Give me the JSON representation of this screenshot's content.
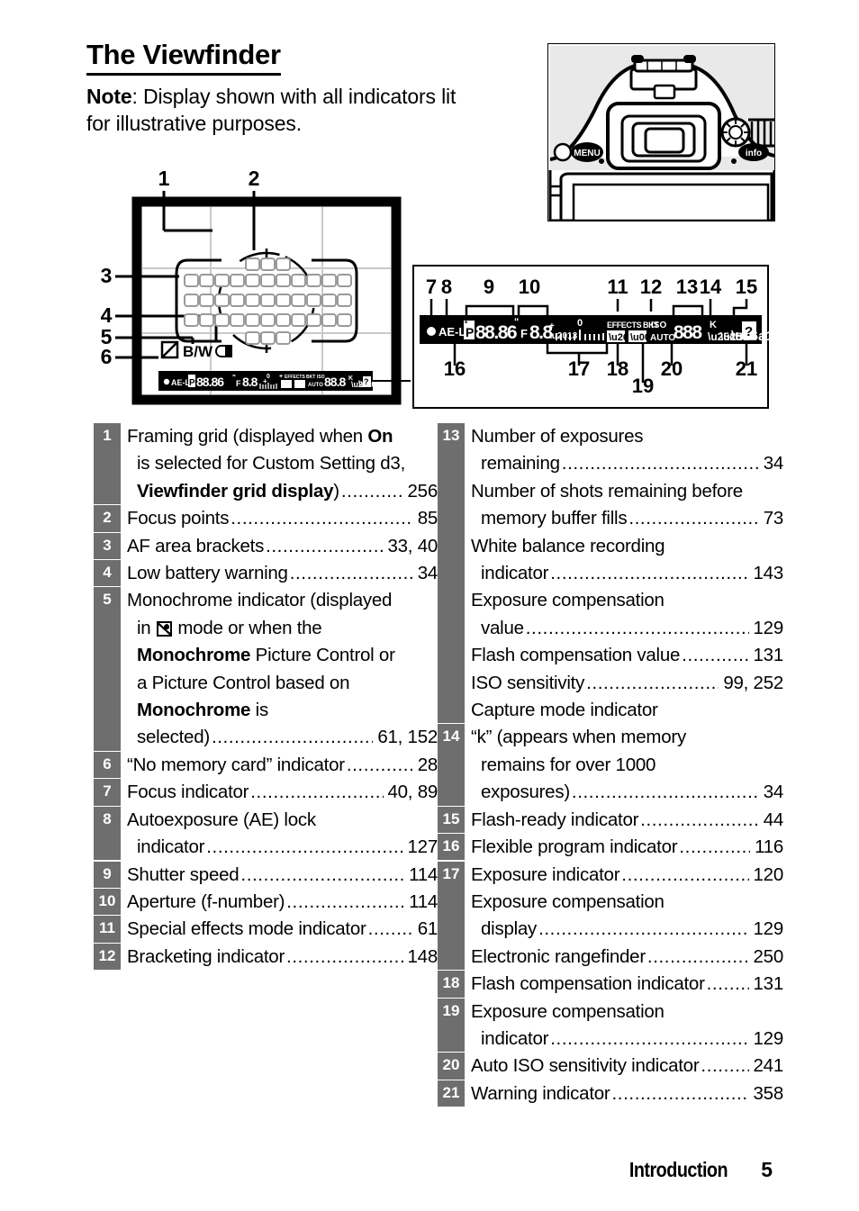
{
  "header": {
    "title": "The Viewfinder",
    "note_bold": "Note",
    "note_rest": ": Display shown with all indicators lit",
    "note_line2": "for illustrative purposes."
  },
  "camera_figure": {
    "name": "camera-rear-view",
    "buttons": [
      "MENU",
      "info"
    ]
  },
  "viewfinder": {
    "monochrome_label": "B/W",
    "status_bar": {
      "focus_dot": "●",
      "ae_lock": "AE-L",
      "flexible_program": "P",
      "shutter_speed": "88.86\"",
      "aperture_prefix": "F",
      "aperture": "8.8",
      "exposure_zero": "0",
      "plus": "+",
      "minus": "–",
      "effects": "EFFECTS",
      "bkt": "BKT",
      "iso": "ISO",
      "auto": "AUTO",
      "exposures": "888",
      "k": "K",
      "flash_ready": "⚡",
      "warning": "?"
    }
  },
  "callouts": {
    "viewfinder": [
      "1",
      "2",
      "3",
      "4",
      "5",
      "6"
    ],
    "detail_top": [
      "7",
      "8",
      "9",
      "10",
      "11",
      "12",
      "13",
      "14",
      "15"
    ],
    "detail_bottom": [
      "16",
      "17",
      "18",
      "19",
      "20",
      "21"
    ]
  },
  "legend": {
    "left": [
      {
        "badge": "1",
        "lines": [
          {
            "type": "plain",
            "text": "Framing grid (displayed when ",
            "bold_tail": "On"
          },
          {
            "type": "plain",
            "text": "is selected for Custom Setting d3,",
            "hang": true
          },
          {
            "type": "dots",
            "label": "Viewfinder grid display",
            "label_bold": true,
            "suffix": ")",
            "page": "256",
            "hang": true,
            "dots": "..."
          }
        ]
      },
      {
        "badge": "2",
        "lines": [
          {
            "type": "dots",
            "label": "Focus points",
            "page": "85"
          }
        ]
      },
      {
        "badge": "3",
        "lines": [
          {
            "type": "dots",
            "label": "AF area brackets",
            "page": "33, 40"
          }
        ]
      },
      {
        "badge": "4",
        "lines": [
          {
            "type": "dots",
            "label": "Low battery warning",
            "page": "34"
          }
        ]
      },
      {
        "badge": "5",
        "lines": [
          {
            "type": "plain",
            "text": "Monochrome indicator (displayed"
          },
          {
            "type": "glyph",
            "pre": "in ",
            "post": " mode or when the",
            "hang": true
          },
          {
            "type": "plain",
            "text": "Monochrome Picture Control or",
            "bold_head": "Monochrome",
            "hang": true
          },
          {
            "type": "plain",
            "text": "a Picture Control based on",
            "hang": true
          },
          {
            "type": "plain",
            "text": "Monochrome is",
            "bold_head": "Monochrome",
            "hang": true
          },
          {
            "type": "dots",
            "label": "selected)",
            "page": "61, 152",
            "hang": true
          }
        ]
      },
      {
        "badge": "6",
        "lines": [
          {
            "type": "dots",
            "label": "“No memory card” indicator",
            "page": "28"
          }
        ]
      },
      {
        "badge": "7",
        "lines": [
          {
            "type": "dots",
            "label": "Focus indicator",
            "page": "40, 89"
          }
        ]
      },
      {
        "badge": "8",
        "lines": [
          {
            "type": "plain",
            "text": "Autoexposure (AE) lock"
          },
          {
            "type": "dots",
            "label": "indicator",
            "page": "127",
            "hang": true
          }
        ]
      },
      {
        "badge": "9",
        "lines": [
          {
            "type": "dots",
            "label": "Shutter speed",
            "page": "114"
          }
        ]
      },
      {
        "badge": "10",
        "lines": [
          {
            "type": "dots",
            "label": "Aperture (f-number)",
            "page": "114"
          }
        ]
      },
      {
        "badge": "11",
        "lines": [
          {
            "type": "dots",
            "label": "Special effects mode indicator",
            "page": "61"
          }
        ]
      },
      {
        "badge": "12",
        "lines": [
          {
            "type": "dots",
            "label": "Bracketing indicator",
            "page": "148"
          }
        ]
      }
    ],
    "right": [
      {
        "badge": "13",
        "lines": [
          {
            "type": "plain",
            "text": "Number of exposures"
          },
          {
            "type": "dots",
            "label": "remaining",
            "page": "34",
            "hang": true
          },
          {
            "type": "plain",
            "text": "Number of shots remaining before"
          },
          {
            "type": "dots",
            "label": "memory buffer fills",
            "page": "73",
            "hang": true
          },
          {
            "type": "plain",
            "text": "White balance recording"
          },
          {
            "type": "dots",
            "label": "indicator",
            "page": "143",
            "hang": true
          },
          {
            "type": "plain",
            "text": "Exposure compensation"
          },
          {
            "type": "dots",
            "label": "value",
            "page": "129",
            "hang": true
          },
          {
            "type": "dots",
            "label": "Flash compensation value",
            "page": "131"
          },
          {
            "type": "dots",
            "label": "ISO sensitivity",
            "page": "99, 252"
          },
          {
            "type": "plain",
            "text": "Capture mode indicator"
          }
        ]
      },
      {
        "badge": "14",
        "lines": [
          {
            "type": "plain",
            "text": "“k” (appears when memory"
          },
          {
            "type": "plain",
            "text": "remains for over 1000",
            "hang": true
          },
          {
            "type": "dots",
            "label": "exposures)",
            "page": "34",
            "hang": true
          }
        ]
      },
      {
        "badge": "15",
        "lines": [
          {
            "type": "dots",
            "label": "Flash-ready indicator",
            "page": "44"
          }
        ]
      },
      {
        "badge": "16",
        "lines": [
          {
            "type": "dots",
            "label": "Flexible program indicator",
            "page": "116"
          }
        ]
      },
      {
        "badge": "17",
        "lines": [
          {
            "type": "dots",
            "label": "Exposure indicator",
            "page": "120"
          },
          {
            "type": "plain",
            "text": "Exposure compensation"
          },
          {
            "type": "dots",
            "label": "display",
            "page": "129",
            "hang": true
          },
          {
            "type": "dots",
            "label": "Electronic rangefinder",
            "page": "250"
          }
        ]
      },
      {
        "badge": "18",
        "lines": [
          {
            "type": "dots",
            "label": "Flash compensation indicator",
            "page": "131"
          }
        ]
      },
      {
        "badge": "19",
        "lines": [
          {
            "type": "plain",
            "text": "Exposure compensation"
          },
          {
            "type": "dots",
            "label": "indicator",
            "page": "129",
            "hang": true
          }
        ]
      },
      {
        "badge": "20",
        "lines": [
          {
            "type": "dots",
            "label": "Auto ISO sensitivity indicator",
            "page": "241"
          }
        ]
      },
      {
        "badge": "21",
        "lines": [
          {
            "type": "dots",
            "label": "Warning indicator",
            "page": "358"
          }
        ]
      }
    ]
  },
  "footer": {
    "chapter": "Introduction",
    "page": "5"
  },
  "colors": {
    "badge_bg": "#6e6e6e",
    "badge_fg": "#ffffff",
    "text": "#000000",
    "page_bg": "#ffffff"
  }
}
